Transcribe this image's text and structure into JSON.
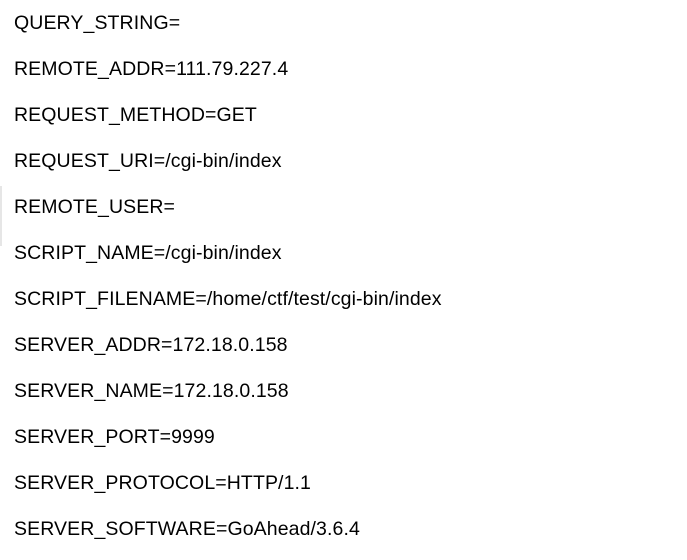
{
  "env_vars": [
    "QUERY_STRING=",
    "REMOTE_ADDR=111.79.227.4",
    "REQUEST_METHOD=GET",
    "REQUEST_URI=/cgi-bin/index",
    "REMOTE_USER=",
    "SCRIPT_NAME=/cgi-bin/index",
    "SCRIPT_FILENAME=/home/ctf/test/cgi-bin/index",
    "SERVER_ADDR=172.18.0.158",
    "SERVER_NAME=172.18.0.158",
    "SERVER_PORT=9999",
    "SERVER_PROTOCOL=HTTP/1.1",
    "SERVER_SOFTWARE=GoAhead/3.6.4"
  ]
}
